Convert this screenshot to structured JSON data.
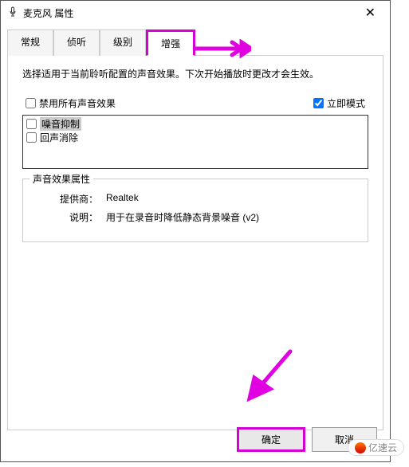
{
  "titlebar": {
    "title": "麦克风 属性",
    "close": "✕"
  },
  "tabs": {
    "items": [
      {
        "label": "常规"
      },
      {
        "label": "侦听"
      },
      {
        "label": "级别"
      },
      {
        "label": "增强"
      }
    ],
    "activeIndex": 3
  },
  "panel": {
    "description": "选择适用于当前聆听配置的声音效果。下次开始播放时更改才会生效。",
    "disableAll": {
      "label": "禁用所有声音效果",
      "checked": false
    },
    "immediateMode": {
      "label": "立即模式",
      "checked": true
    },
    "effects": [
      {
        "label": "噪音抑制",
        "checked": false,
        "selected": true
      },
      {
        "label": "回声消除",
        "checked": false,
        "selected": false
      }
    ],
    "group": {
      "legend": "声音效果属性",
      "vendorLabel": "提供商：",
      "vendor": "Realtek",
      "descLabel": "说明：",
      "desc": "用于在录音时降低静态背景噪音 (v2)"
    }
  },
  "buttons": {
    "ok": "确定",
    "cancel": "取消"
  },
  "watermark": "亿速云",
  "colors": {
    "highlight": "#d400d4"
  }
}
